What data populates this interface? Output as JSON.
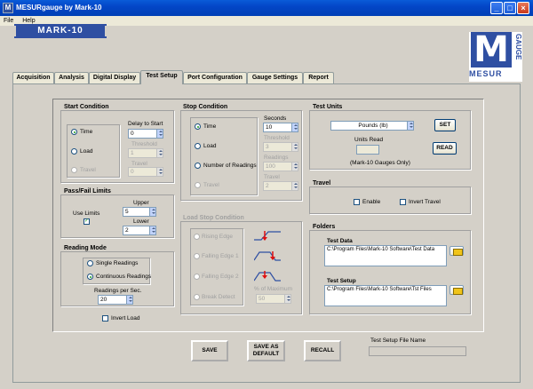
{
  "window": {
    "title": "MESURgauge by Mark-10",
    "min": "_",
    "max": "□",
    "close": "×"
  },
  "menu": [
    "File",
    "Help"
  ],
  "brand": {
    "logo": "MARK-10",
    "mesur_letter": "M",
    "mesur_word": "MESUR",
    "gauge_word": "GAUGE"
  },
  "tabs": [
    "Acquisition",
    "Analysis",
    "Digital Display",
    "Test Setup",
    "Port Configuration",
    "Gauge Settings",
    "Report"
  ],
  "start_condition": {
    "title": "Start Condition",
    "options": [
      "Time",
      "Load",
      "Travel"
    ],
    "delay_label": "Delay to Start",
    "delay_value": "0",
    "threshold_label": "Threshold",
    "threshold_value": "1",
    "travel_label": "Travel",
    "travel_value": "0"
  },
  "passfail": {
    "title": "Pass/Fail Limits",
    "use_limits": "Use Limits",
    "upper_label": "Upper",
    "upper_value": "5",
    "lower_label": "Lower",
    "lower_value": "2",
    "check": "✓"
  },
  "reading_mode": {
    "title": "Reading Mode",
    "options": [
      "Single Readings",
      "Continuous Readings"
    ],
    "rate_label": "Readings per Sec.",
    "rate_value": "20"
  },
  "invert_load": "Invert Load",
  "stop_condition": {
    "title": "Stop Condition",
    "options": [
      "Time",
      "Load",
      "Number of Readings",
      "Travel"
    ],
    "seconds_label": "Seconds",
    "seconds_value": "10",
    "threshold_label": "Threshold",
    "threshold_value": "3",
    "readings_label": "Readings",
    "readings_value": "100",
    "travel_label": "Travel",
    "travel_value": "2"
  },
  "load_stop": {
    "title": "Load Stop Condition",
    "options": [
      "Rising Edge",
      "Falling Edge 1",
      "Falling Edge 2",
      "Break Detect"
    ],
    "pct_label": "% of Maximum",
    "pct_value": "50"
  },
  "test_units": {
    "title": "Test Units",
    "unit": "Pounds (lb)",
    "set": "SET",
    "units_read_label": "Units Read",
    "read": "READ",
    "note": "(Mark-10 Gauges Only)"
  },
  "travel": {
    "title": "Travel",
    "enable": "Enable",
    "invert": "Invert Travel"
  },
  "folders": {
    "title": "Folders",
    "data_label": "Test Data",
    "data_path": "C:\\Program Files\\Mark-10 Software\\Test Data",
    "setup_label": "Test Setup",
    "setup_path": "C:\\Program Files\\Mark-10 Software\\Tst Files"
  },
  "actions": {
    "save": "SAVE",
    "save_default_1": "SAVE AS",
    "save_default_2": "DEFAULT",
    "recall": "RECALL",
    "file_name_label": "Test Setup File Name",
    "file_name_value": ""
  },
  "colors": {
    "title_bar": "#0346c7",
    "brand": "#2f4fa2",
    "signal": "#e01010"
  }
}
